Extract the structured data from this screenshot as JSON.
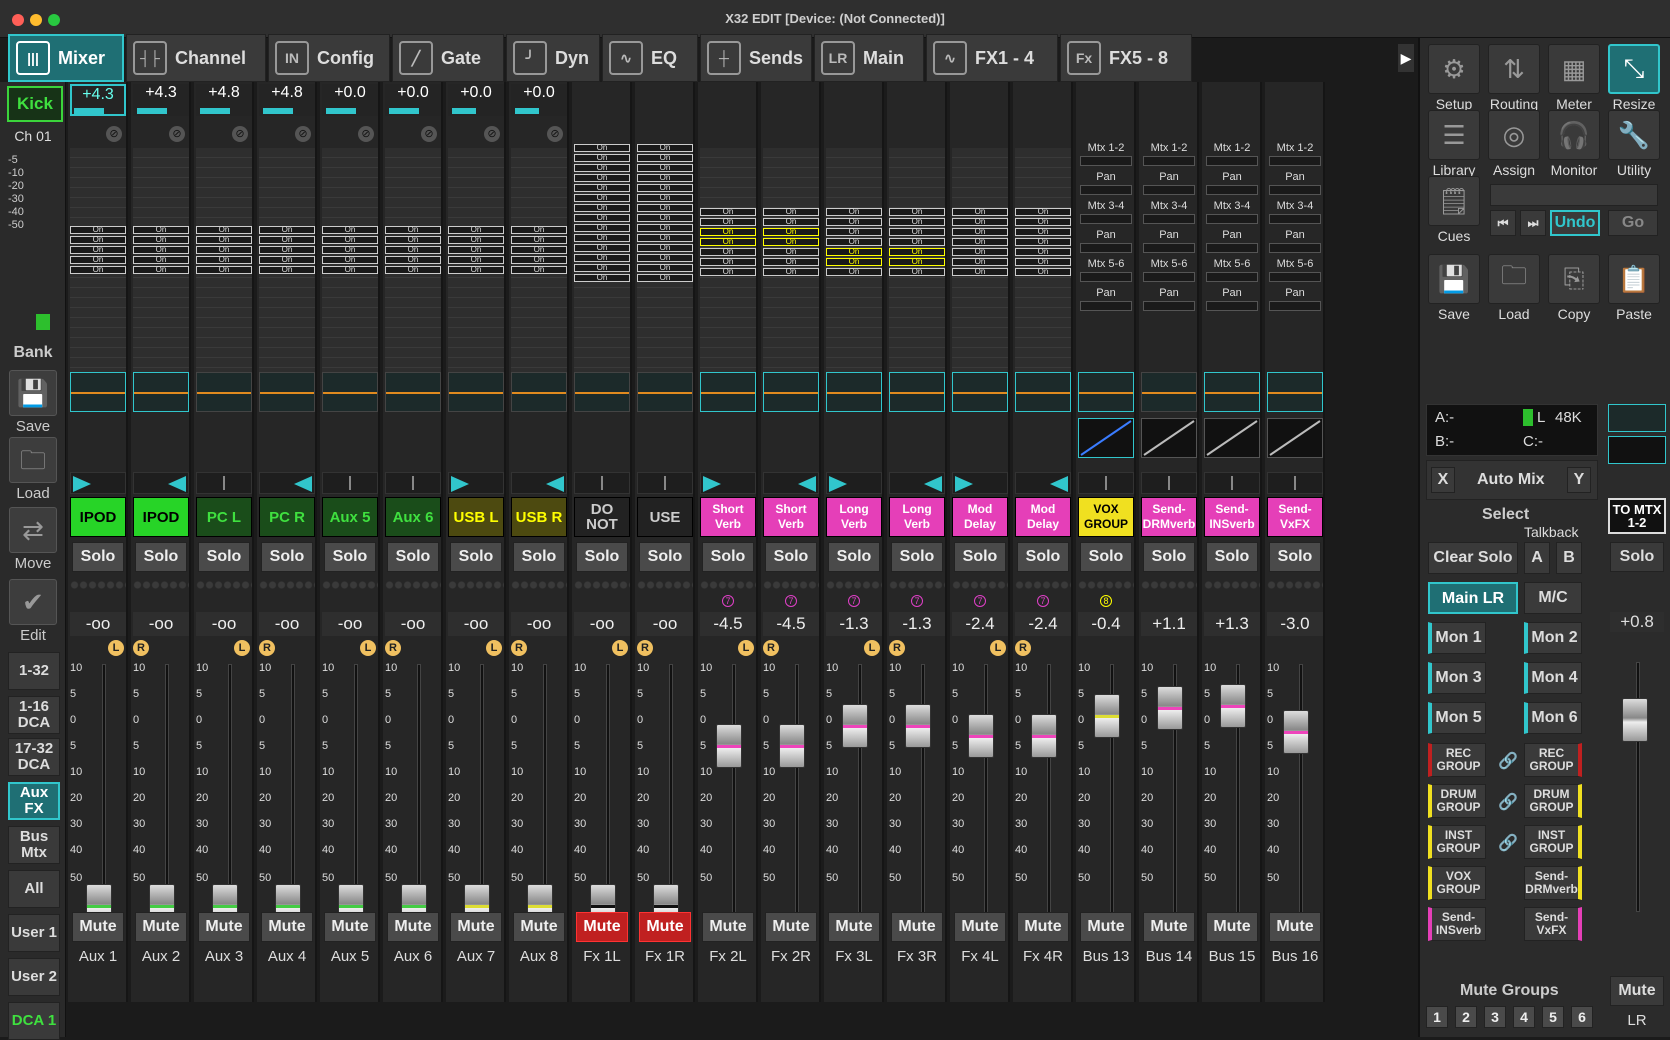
{
  "window": {
    "title": "X32 EDIT [Device: (Not Connected)]"
  },
  "tabs": [
    {
      "label": "Mixer",
      "icon": "mixer-icon",
      "active": true
    },
    {
      "label": "Channel",
      "icon": "channel-icon"
    },
    {
      "label": "Config",
      "icon": "config-icon"
    },
    {
      "label": "Gate",
      "icon": "gate-icon"
    },
    {
      "label": "Dyn",
      "icon": "dyn-icon"
    },
    {
      "label": "EQ",
      "icon": "eq-icon"
    },
    {
      "label": "Sends",
      "icon": "sends-icon"
    },
    {
      "label": "Main",
      "icon": "main-icon"
    },
    {
      "label": "FX1 - 4",
      "icon": "fx1-icon"
    },
    {
      "label": "FX5 - 8",
      "icon": "fx5-icon"
    }
  ],
  "left": {
    "selected": "Kick",
    "channel": "Ch 01",
    "scale": [
      "-5",
      "-10",
      "-20",
      "-30",
      "-40",
      "-50"
    ],
    "bank_label": "Bank",
    "save": "Save",
    "load": "Load",
    "move": "Move",
    "edit": "Edit",
    "banks": [
      "1-32",
      "1-16 DCA",
      "17-32 DCA",
      "Aux FX",
      "Bus Mtx",
      "All",
      "User 1",
      "User 2",
      "DCA 1"
    ]
  },
  "strip_common": {
    "solo": "Solo",
    "mute": "Mute",
    "send_on": "On",
    "L": "L",
    "R": "R",
    "scale": [
      "10",
      "5",
      "0",
      "5",
      "10",
      "20",
      "30",
      "40",
      "50"
    ]
  },
  "strips": [
    {
      "label": "Aux 1",
      "name": "IPOD",
      "gain": "+4.3",
      "level": "-oo",
      "color": "#27d427",
      "fader_line": "#4c4"
    },
    {
      "label": "Aux 2",
      "name": "IPOD",
      "gain": "+4.3",
      "level": "-oo",
      "color": "#27d427",
      "fader_line": "#4c4"
    },
    {
      "label": "Aux 3",
      "name": "PC L",
      "gain": "+4.8",
      "level": "-oo",
      "color": "#1a4d1a",
      "fader_line": "#4c4"
    },
    {
      "label": "Aux 4",
      "name": "PC R",
      "gain": "+4.8",
      "level": "-oo",
      "color": "#1a4d1a",
      "fader_line": "#4c4"
    },
    {
      "label": "Aux 5",
      "name": "Aux 5",
      "gain": "+0.0",
      "level": "-oo",
      "color": "#1a4d1a",
      "fader_line": "#4c4"
    },
    {
      "label": "Aux 6",
      "name": "Aux 6",
      "gain": "+0.0",
      "level": "-oo",
      "color": "#1a4d1a",
      "fader_line": "#4c4"
    },
    {
      "label": "Aux 7",
      "name": "USB L",
      "gain": "+0.0",
      "level": "-oo",
      "color": "#4d4a10",
      "fader_line": "#dd3"
    },
    {
      "label": "Aux 8",
      "name": "USB R",
      "gain": "+0.0",
      "level": "-oo",
      "color": "#4d4a10",
      "fader_line": "#dd3"
    },
    {
      "label": "Fx 1L",
      "name": "DO NOT",
      "gain": "",
      "level": "-oo",
      "color": "#222222",
      "fader_line": "#111",
      "muted": true
    },
    {
      "label": "Fx 1R",
      "name": "USE",
      "gain": "",
      "level": "-oo",
      "color": "#222222",
      "fader_line": "#111",
      "muted": true
    },
    {
      "label": "Fx 2L",
      "name": "Short Verb",
      "gain": "",
      "level": "-4.5",
      "color": "#e53fb8",
      "fader_line": "#e4b"
    },
    {
      "label": "Fx 2R",
      "name": "Short Verb",
      "gain": "",
      "level": "-4.5",
      "color": "#e53fb8",
      "fader_line": "#e4b"
    },
    {
      "label": "Fx 3L",
      "name": "Long Verb",
      "gain": "",
      "level": "-1.3",
      "color": "#e53fb8",
      "fader_line": "#e4b"
    },
    {
      "label": "Fx 3R",
      "name": "Long Verb",
      "gain": "",
      "level": "-1.3",
      "color": "#e53fb8",
      "fader_line": "#e4b"
    },
    {
      "label": "Fx 4L",
      "name": "Mod Delay",
      "gain": "",
      "level": "-2.4",
      "color": "#e53fb8",
      "fader_line": "#e4b"
    },
    {
      "label": "Fx 4R",
      "name": "Mod Delay",
      "gain": "",
      "level": "-2.4",
      "color": "#e53fb8",
      "fader_line": "#e4b"
    },
    {
      "label": "Bus 13",
      "name": "VOX GROUP",
      "gain": "",
      "level": "-0.4",
      "color": "#f0e020",
      "fader_line": "#dd3"
    },
    {
      "label": "Bus 14",
      "name": "Send-DRMverb",
      "gain": "",
      "level": "+1.1",
      "color": "#e53fb8",
      "fader_line": "#e4b"
    },
    {
      "label": "Bus 15",
      "name": "Send-INSverb",
      "gain": "",
      "level": "+1.3",
      "color": "#e53fb8",
      "fader_line": "#e4b"
    },
    {
      "label": "Bus 16",
      "name": "Send-VxFX",
      "gain": "",
      "level": "-3.0",
      "color": "#e53fb8",
      "fader_line": "#e4b"
    }
  ],
  "bus_sends": [
    "Mtx 1-2",
    "Pan",
    "Mtx 3-4",
    "Pan",
    "Mtx 5-6",
    "Pan"
  ],
  "right": {
    "icons": [
      "Setup",
      "Routing",
      "Meter",
      "Resize",
      "Library",
      "Assign",
      "Monitor",
      "Utility",
      "Cues"
    ],
    "undo": "Undo",
    "go": "Go",
    "bottom_icons": [
      "Save",
      "Load",
      "Copy",
      "Paste"
    ],
    "clock_a": "A:-",
    "clock_l": "L",
    "clock_rate": "48K",
    "clock_b": "B:-",
    "clock_c": "C:-",
    "automix_x": "X",
    "automix": "Auto Mix",
    "automix_y": "Y",
    "select": "Select",
    "talkback": "Talkback",
    "clear_solo": "Clear Solo",
    "tb_a": "A",
    "tb_b": "B",
    "main_lr": "Main LR",
    "mc": "M/C",
    "mons": [
      "Mon 1",
      "Mon 2",
      "Mon 3",
      "Mon 4",
      "Mon 5",
      "Mon 6"
    ],
    "groups_left": [
      "REC GROUP",
      "DRUM GROUP",
      "INST GROUP",
      "VOX GROUP",
      "Send-INSverb"
    ],
    "groups_right": [
      "REC GROUP",
      "DRUM GROUP",
      "INST GROUP",
      "Send-DRMverb",
      "Send-VxFX"
    ],
    "mute_groups": "Mute Groups",
    "mute_group_nums": [
      "1",
      "2",
      "3",
      "4",
      "5",
      "6"
    ],
    "to_mtx": "TO MTX 1-2",
    "master_solo": "Solo",
    "master_level": "+0.8",
    "master_mute": "Mute",
    "master_label": "LR"
  }
}
